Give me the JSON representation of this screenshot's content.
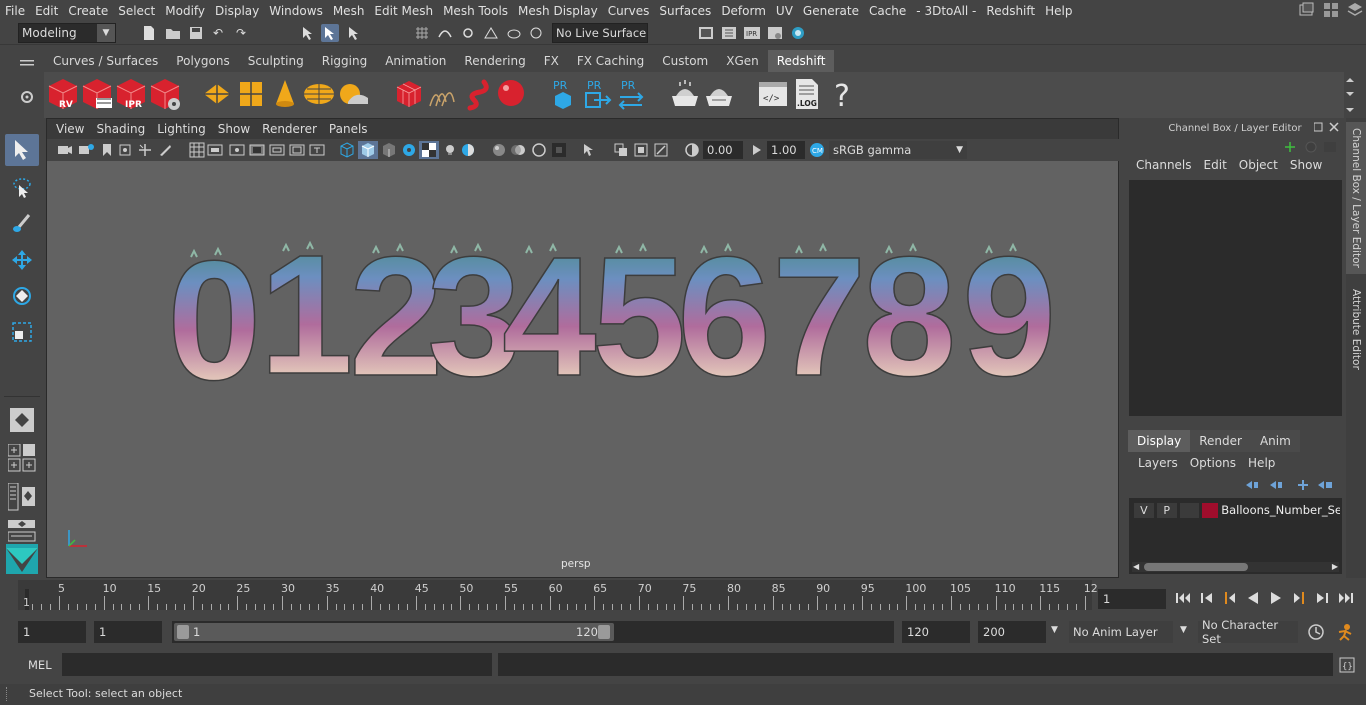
{
  "menubar": {
    "items": [
      "File",
      "Edit",
      "Create",
      "Select",
      "Modify",
      "Display",
      "Windows",
      "Mesh",
      "Edit Mesh",
      "Mesh Tools",
      "Mesh Display",
      "Curves",
      "Surfaces",
      "Deform",
      "UV",
      "Generate",
      "Cache",
      "- 3DtoAll -",
      "Redshift",
      "Help"
    ]
  },
  "statusline": {
    "mode": "Modeling",
    "live_surface": "No Live Surface"
  },
  "shelf": {
    "tabs": [
      "Curves / Surfaces",
      "Polygons",
      "Sculpting",
      "Rigging",
      "Animation",
      "Rendering",
      "FX",
      "FX Caching",
      "Custom",
      "XGen",
      "Redshift"
    ],
    "active_tab": "Redshift",
    "icon_labels": {
      "rv": "RV",
      "ipr": "IPR",
      "pr1": "PR",
      "pr2": "PR",
      "pr3": "PR",
      "log": ".LOG",
      "help": "?"
    }
  },
  "viewport": {
    "menu": [
      "View",
      "Shading",
      "Lighting",
      "Show",
      "Renderer",
      "Panels"
    ],
    "exposure": "0.00",
    "gamma": "1.00",
    "color_space": "sRGB gamma",
    "camera": "persp",
    "digits": [
      "0",
      "1",
      "2",
      "3",
      "4",
      "5",
      "6",
      "7",
      "8",
      "9"
    ]
  },
  "channel_box": {
    "title": "Channel Box / Layer Editor",
    "menu": [
      "Channels",
      "Edit",
      "Object",
      "Show"
    ],
    "layer_tabs": [
      "Display",
      "Render",
      "Anim"
    ],
    "active_layer_tab": "Display",
    "layer_menu": [
      "Layers",
      "Options",
      "Help"
    ],
    "layer": {
      "visible": "V",
      "playback": "P",
      "name": "Balloons_Number_Set_",
      "color": "#a00d2c"
    }
  },
  "side_tabs": [
    "Channel Box / Layer Editor",
    "Attribute Editor"
  ],
  "timeline": {
    "start_marker": "1",
    "ticks": [
      "5",
      "10",
      "15",
      "20",
      "25",
      "30",
      "35",
      "40",
      "45",
      "50",
      "55",
      "60",
      "65",
      "70",
      "75",
      "80",
      "85",
      "90",
      "95",
      "100",
      "105",
      "110",
      "115",
      "12"
    ],
    "current_frame": "1"
  },
  "range": {
    "start": "1",
    "playback_start": "1",
    "slider_start": "1",
    "slider_end": "120",
    "playback_end": "120",
    "end": "200",
    "anim_layer": "No Anim Layer",
    "character_set": "No Character Set"
  },
  "command_line": {
    "language": "MEL"
  },
  "help_line": {
    "text": "Select Tool: select an object"
  }
}
